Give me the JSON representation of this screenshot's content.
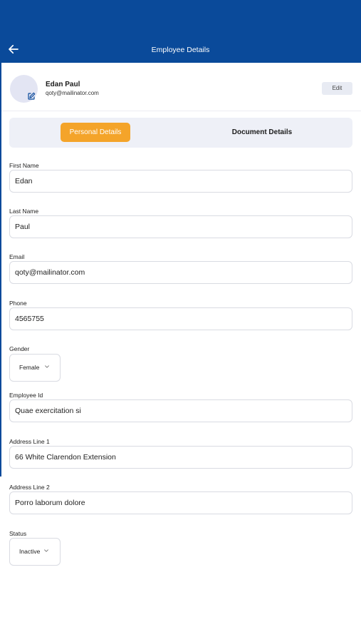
{
  "appbar": {
    "title": "Employee Details",
    "back_icon": "arrow-left-icon"
  },
  "profile": {
    "name": "Edan Paul",
    "email": "qoty@mailinator.com",
    "edit_label": "Edit",
    "avatar_edit_icon": "edit-square-icon"
  },
  "tabs": {
    "active": "Personal Details",
    "inactive": "Document Details"
  },
  "fields": {
    "first_name": {
      "label": "First Name",
      "value": "Edan"
    },
    "last_name": {
      "label": "Last Name",
      "value": "Paul"
    },
    "email": {
      "label": "Email",
      "value": "qoty@mailinator.com"
    },
    "phone": {
      "label": "Phone",
      "value": "4565755"
    },
    "gender": {
      "label": "Gender",
      "value": "Female"
    },
    "employee_id": {
      "label": "Employee Id",
      "value": "Quae exercitation si"
    },
    "address1": {
      "label": "Address Line 1",
      "value": "66 White Clarendon Extension"
    },
    "address2": {
      "label": "Address Line 2",
      "value": "Porro laborum dolore"
    },
    "status": {
      "label": "Status",
      "value": "Inactive"
    }
  },
  "colors": {
    "primary": "#0a4a9a",
    "accent": "#f4a42a",
    "tab_bg": "#eef0f7",
    "avatar_bg": "#e3e5f3"
  }
}
